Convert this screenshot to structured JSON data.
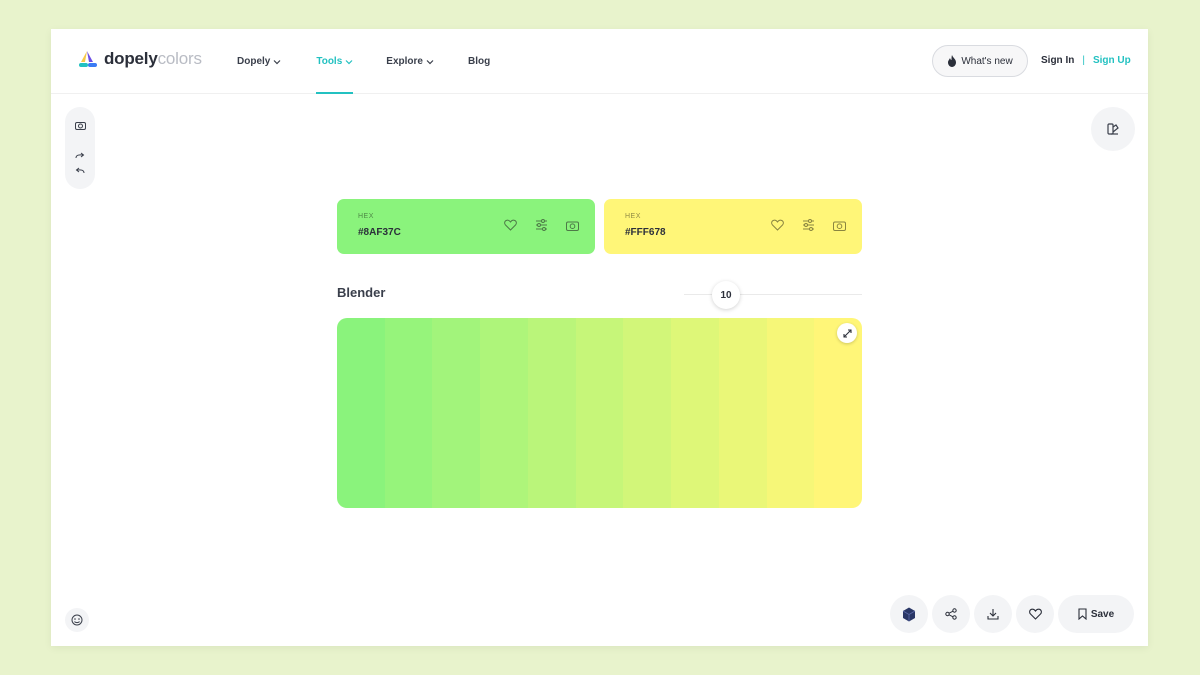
{
  "brand": {
    "name_primary": "dopely",
    "name_secondary": "colors"
  },
  "nav": [
    {
      "label": "Dopely",
      "has_dropdown": true,
      "active": false
    },
    {
      "label": "Tools",
      "has_dropdown": true,
      "active": true
    },
    {
      "label": "Explore",
      "has_dropdown": true,
      "active": false
    },
    {
      "label": "Blog",
      "has_dropdown": false,
      "active": false
    }
  ],
  "header": {
    "whats_new": "What's new",
    "sign_in": "Sign In",
    "separator": "|",
    "sign_up": "Sign Up"
  },
  "colors": [
    {
      "label": "HEX",
      "hex": "#8AF37C",
      "bg": "#8af37c"
    },
    {
      "label": "HEX",
      "hex": "#FFF678",
      "bg": "#fff678"
    }
  ],
  "blender": {
    "title": "Blender",
    "steps": "10",
    "swatches": [
      "#8af37c",
      "#96f47b",
      "#a2f47b",
      "#aef57a",
      "#baf57a",
      "#c6f679",
      "#d2f679",
      "#deF778",
      "#eaf778",
      "#f6f778",
      "#fff678"
    ]
  },
  "actions": {
    "save": "Save"
  },
  "theme": {
    "accent": "#23c1c1",
    "surface": "#f3f4f6",
    "page_bg": "#e8f3cc"
  }
}
